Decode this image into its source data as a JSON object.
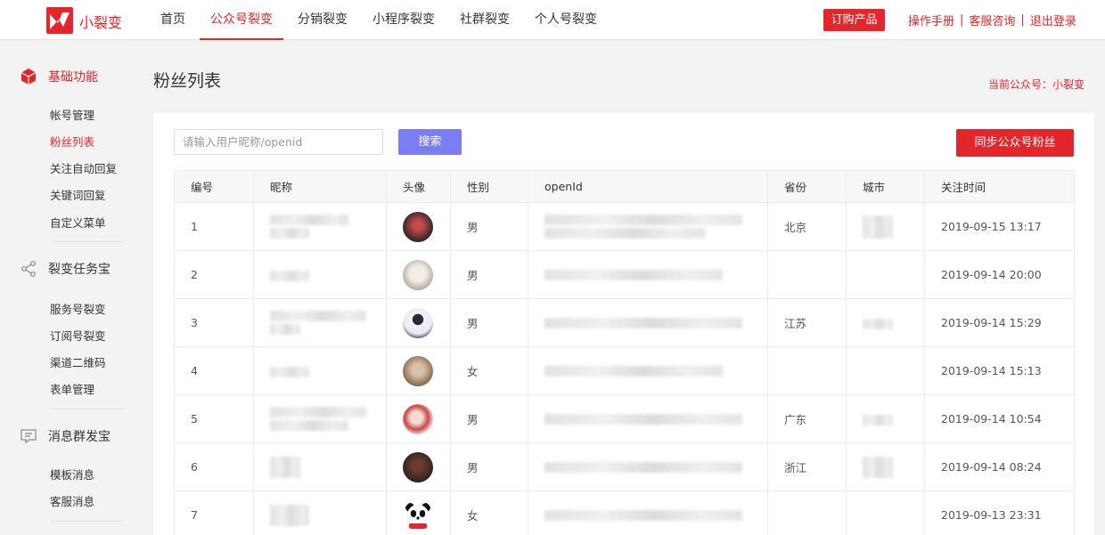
{
  "header": {
    "brand": "小裂变",
    "nav": [
      "首页",
      "公众号裂变",
      "分销裂变",
      "小程序裂变",
      "社群裂变",
      "个人号裂变"
    ],
    "active_nav": 1,
    "order_button": "订购产品",
    "links": [
      "操作手册",
      "客服咨询",
      "退出登录"
    ],
    "separator": "|"
  },
  "sidebar": {
    "sections": [
      {
        "title": "基础功能",
        "icon": "cube-icon",
        "items": [
          "帐号管理",
          "粉丝列表",
          "关注自动回复",
          "关键词回复",
          "自定义菜单"
        ]
      },
      {
        "title": "裂变任务宝",
        "icon": "share-icon",
        "items": [
          "服务号裂变",
          "订阅号裂变",
          "渠道二维码",
          "表单管理"
        ]
      },
      {
        "title": "消息群发宝",
        "icon": "message-icon",
        "items": [
          "模板消息",
          "客服消息"
        ]
      }
    ],
    "active_item": "粉丝列表"
  },
  "main": {
    "title": "粉丝列表",
    "current_account": "当前公众号：小裂变",
    "search": {
      "placeholder": "请输入用户昵称/openid",
      "button": "搜索"
    },
    "sync_button": "同步公众号粉丝",
    "table": {
      "columns": [
        "编号",
        "昵称",
        "头像",
        "性别",
        "openId",
        "省份",
        "城市",
        "关注时间"
      ],
      "rows": [
        {
          "id": "1",
          "gender": "男",
          "province": "北京",
          "city_blurred": true,
          "time": "2019-09-15 13:17"
        },
        {
          "id": "2",
          "gender": "男",
          "province": "",
          "city_blurred": false,
          "time": "2019-09-14 20:00"
        },
        {
          "id": "3",
          "gender": "男",
          "province": "江苏",
          "city_blurred": true,
          "time": "2019-09-14 15:29"
        },
        {
          "id": "4",
          "gender": "女",
          "province": "",
          "city_blurred": false,
          "time": "2019-09-14 15:13"
        },
        {
          "id": "5",
          "gender": "男",
          "province": "广东",
          "city_blurred": true,
          "time": "2019-09-14 10:54"
        },
        {
          "id": "6",
          "gender": "男",
          "province": "浙江",
          "city_blurred": true,
          "time": "2019-09-14 08:24"
        },
        {
          "id": "7",
          "gender": "女",
          "province": "",
          "city_blurred": false,
          "time": "2019-09-13 23:31"
        }
      ]
    }
  },
  "colors": {
    "accent": "#e4262c",
    "search_button": "#7b7df5"
  }
}
